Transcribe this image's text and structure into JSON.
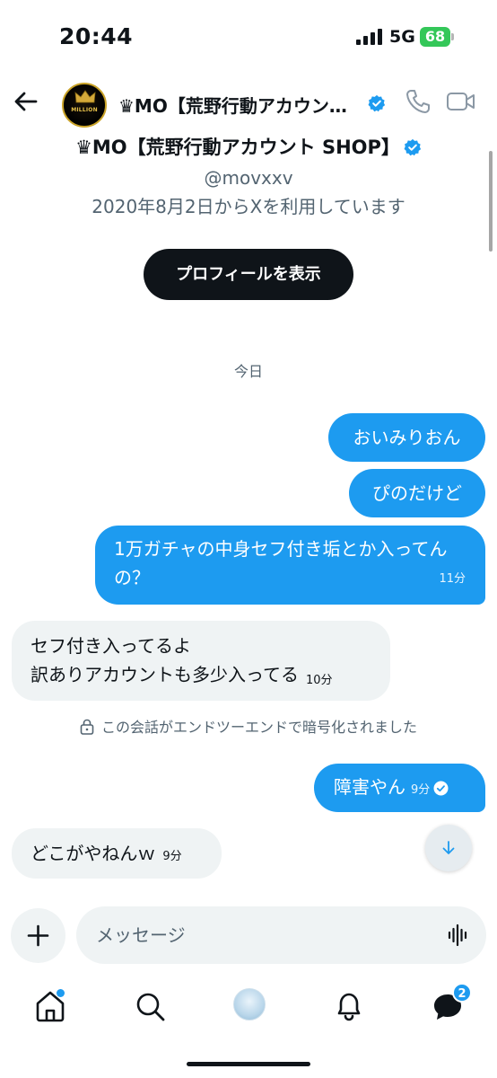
{
  "status_bar": {
    "time": "20:44",
    "network": "5G",
    "battery": "68"
  },
  "header": {
    "title": "♛MO【荒野行動アカウン…",
    "avatar_text": "MILLION",
    "accent_color": "#1d9bf0"
  },
  "profile": {
    "name": "♛MO【荒野行動アカウント SHOP】",
    "handle": "@movxxv",
    "joined": "2020年8月2日からXを利用しています",
    "view_profile_label": "プロフィールを表示"
  },
  "conversation": {
    "date_divider": "今日",
    "messages": [
      {
        "direction": "outgoing",
        "text": "おいみりおん",
        "time": ""
      },
      {
        "direction": "outgoing",
        "text": "ぴのだけど",
        "time": ""
      },
      {
        "direction": "outgoing",
        "text": "1万ガチャの中身セフ付き垢とか入ってんの？",
        "time": "11分"
      },
      {
        "direction": "incoming",
        "line1": "セフ付き入ってるよ",
        "line2": "訳ありアカウントも多少入ってる",
        "time": "10分"
      },
      {
        "direction": "outgoing",
        "text": "障害やん",
        "time": "9分",
        "read": true
      },
      {
        "direction": "incoming",
        "text": "どこがやねんｗ",
        "time": "9分"
      }
    ],
    "e2e_notice": "この会話がエンドツーエンドで暗号化されました"
  },
  "composer": {
    "placeholder": "メッセージ"
  },
  "bottom_nav": {
    "items": [
      "home-icon",
      "search-icon",
      "grok-icon",
      "bell-icon",
      "messages-icon"
    ],
    "messages_badge": "2"
  }
}
